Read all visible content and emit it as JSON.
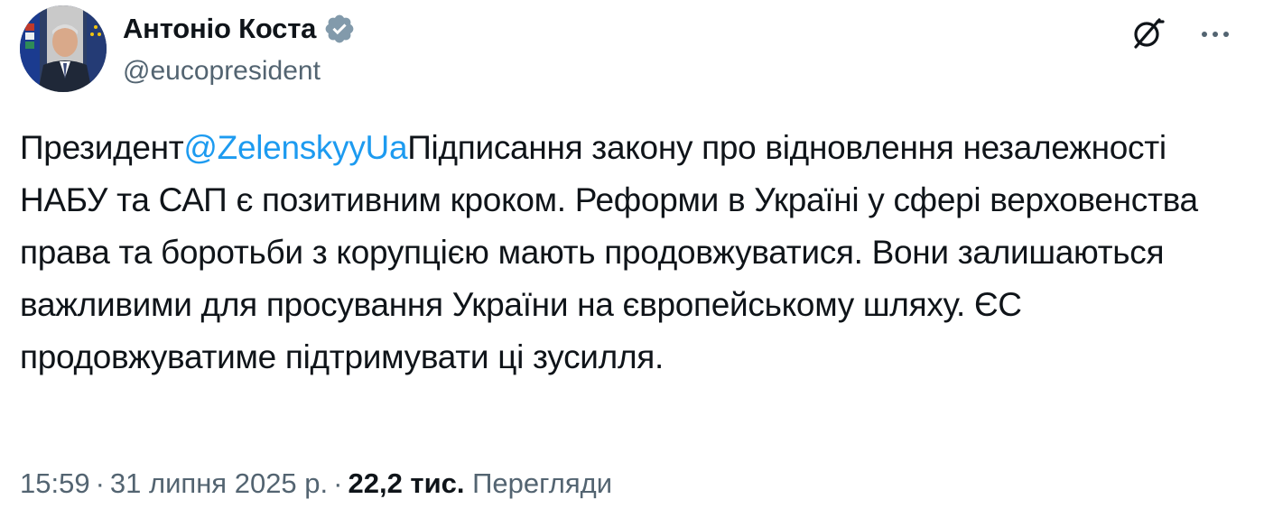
{
  "author": {
    "display_name": "Антоніо Коста",
    "handle": "@eucopresident",
    "verified": true,
    "avatar_icon": "portrait-photo"
  },
  "actions": {
    "grok_icon": "grok-icon",
    "more_icon": "more-icon"
  },
  "tweet": {
    "prefix": "Президент",
    "mention": "@ZelenskyyUa",
    "text": "Підписання закону про відновлення незалежності НАБУ та САП є позитивним кроком. Реформи в Україні у сфері верховенства права та боротьби з корупцією мають продовжуватися. Вони залишаються важливими для просування України на європейському шляху. ЄС продовжуватиме підтримувати ці зусилля."
  },
  "meta": {
    "time": "15:59",
    "separator": "·",
    "date": "31 липня 2025 р.",
    "views_count": "22,2 тис.",
    "views_label": "Перегляди"
  },
  "colors": {
    "text": "#0f1419",
    "secondary": "#536471",
    "link": "#1d9bf0",
    "verified_badge": "#829aab"
  }
}
